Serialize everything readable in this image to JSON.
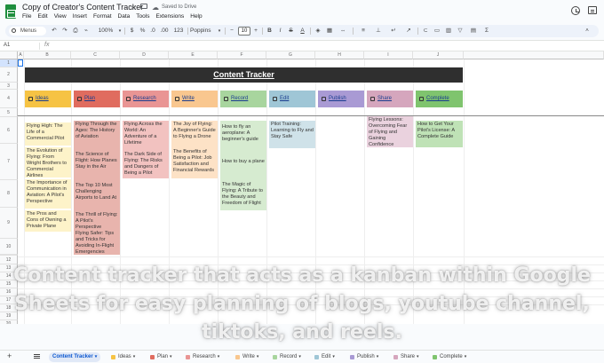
{
  "title": "Copy of Creator's Content Tracker",
  "saved": "Saved to Drive",
  "menu": [
    "File",
    "Edit",
    "View",
    "Insert",
    "Format",
    "Data",
    "Tools",
    "Extensions",
    "Help"
  ],
  "toolbar": {
    "search": "Menus",
    "zoom": "100%",
    "currency": "$",
    "percent": "%",
    "dec_dec": ".0",
    "dec_inc": ".00",
    "num_format": "123",
    "font": "Poppins",
    "font_size": "10",
    "bold": "B",
    "italic": "I",
    "strike": "S",
    "text_color": "A"
  },
  "namebox": "A1",
  "fx": "fx",
  "columns": [
    "A",
    "B",
    "C",
    "D",
    "E",
    "F",
    "G",
    "H",
    "I",
    "J"
  ],
  "rows": [
    "1",
    "2",
    "3",
    "4",
    "5",
    "6",
    "7",
    "8",
    "9",
    "10",
    "11",
    "12",
    "13",
    "14",
    "15",
    "16",
    "17",
    "18",
    "19",
    "20",
    "21",
    "22"
  ],
  "banner": "Content Tracker",
  "headers": [
    {
      "label": "Ideas",
      "color": "#f6c344"
    },
    {
      "label": "Plan",
      "color": "#e06c5f"
    },
    {
      "label": "Research",
      "color": "#e99594"
    },
    {
      "label": "Write",
      "color": "#f9c78f"
    },
    {
      "label": "Record",
      "color": "#a8d59e"
    },
    {
      "label": "Edit",
      "color": "#9fc6d6"
    },
    {
      "label": "Publish",
      "color": "#a99ad4"
    },
    {
      "label": "Share",
      "color": "#d5a6bd"
    },
    {
      "label": "Complete",
      "color": "#7fc46e"
    }
  ],
  "cards": {
    "ideas": [
      "Flying High: The Life of a Commercial Pilot",
      "The Evolution of Flying: From Wright Brothers to Commercial Airlines",
      "The Importance of Communication in Aviation: A Pilot's Perspective",
      "The Pros and Cons of Owning a Private Plane"
    ],
    "plan": [
      "Flying Through the Ages: The History of Aviation",
      "The Science of Flight: How Planes Stay in the Air",
      "The Top 10 Most Challenging Airports to Land At",
      "The Thrill of Flying: A Pilot's Perspective",
      "Flying Safer: Tips and Tricks for Avoiding In-Flight Emergencies"
    ],
    "research": [
      "Flying Across the World: An Adventure of a Lifetime",
      "The Dark Side of Flying: The Risks and Dangers of Being a Pilot"
    ],
    "write": [
      "The Joy of Flying: A Beginner's Guide to Flying a Drone",
      "The Benefits of Being a Pilot: Job Satisfaction and Financial Rewards"
    ],
    "record": [
      "How to fly an aeroplane: A beginner's guide",
      "How to buy a plane",
      "The Magic of Flying: A Tribute to the Beauty and Freedom of Flight"
    ],
    "edit": [
      "Pilot Training: Learning to Fly and Stay Safe"
    ],
    "share": [
      "Flying Lessons: Overcoming Fear of Flying and Gaining Confidence"
    ],
    "complete": [
      "How to Get Your Pilot's License: A Complete Guide"
    ]
  },
  "caption": "Content tracker that acts as a kanban within Google Sheets for easy planning of blogs, youtube channel, tiktoks, and reels.",
  "tabs": [
    "Content Tracker",
    "Ideas",
    "Plan",
    "Research",
    "Write",
    "Record",
    "Edit",
    "Publish",
    "Share",
    "Complete"
  ]
}
